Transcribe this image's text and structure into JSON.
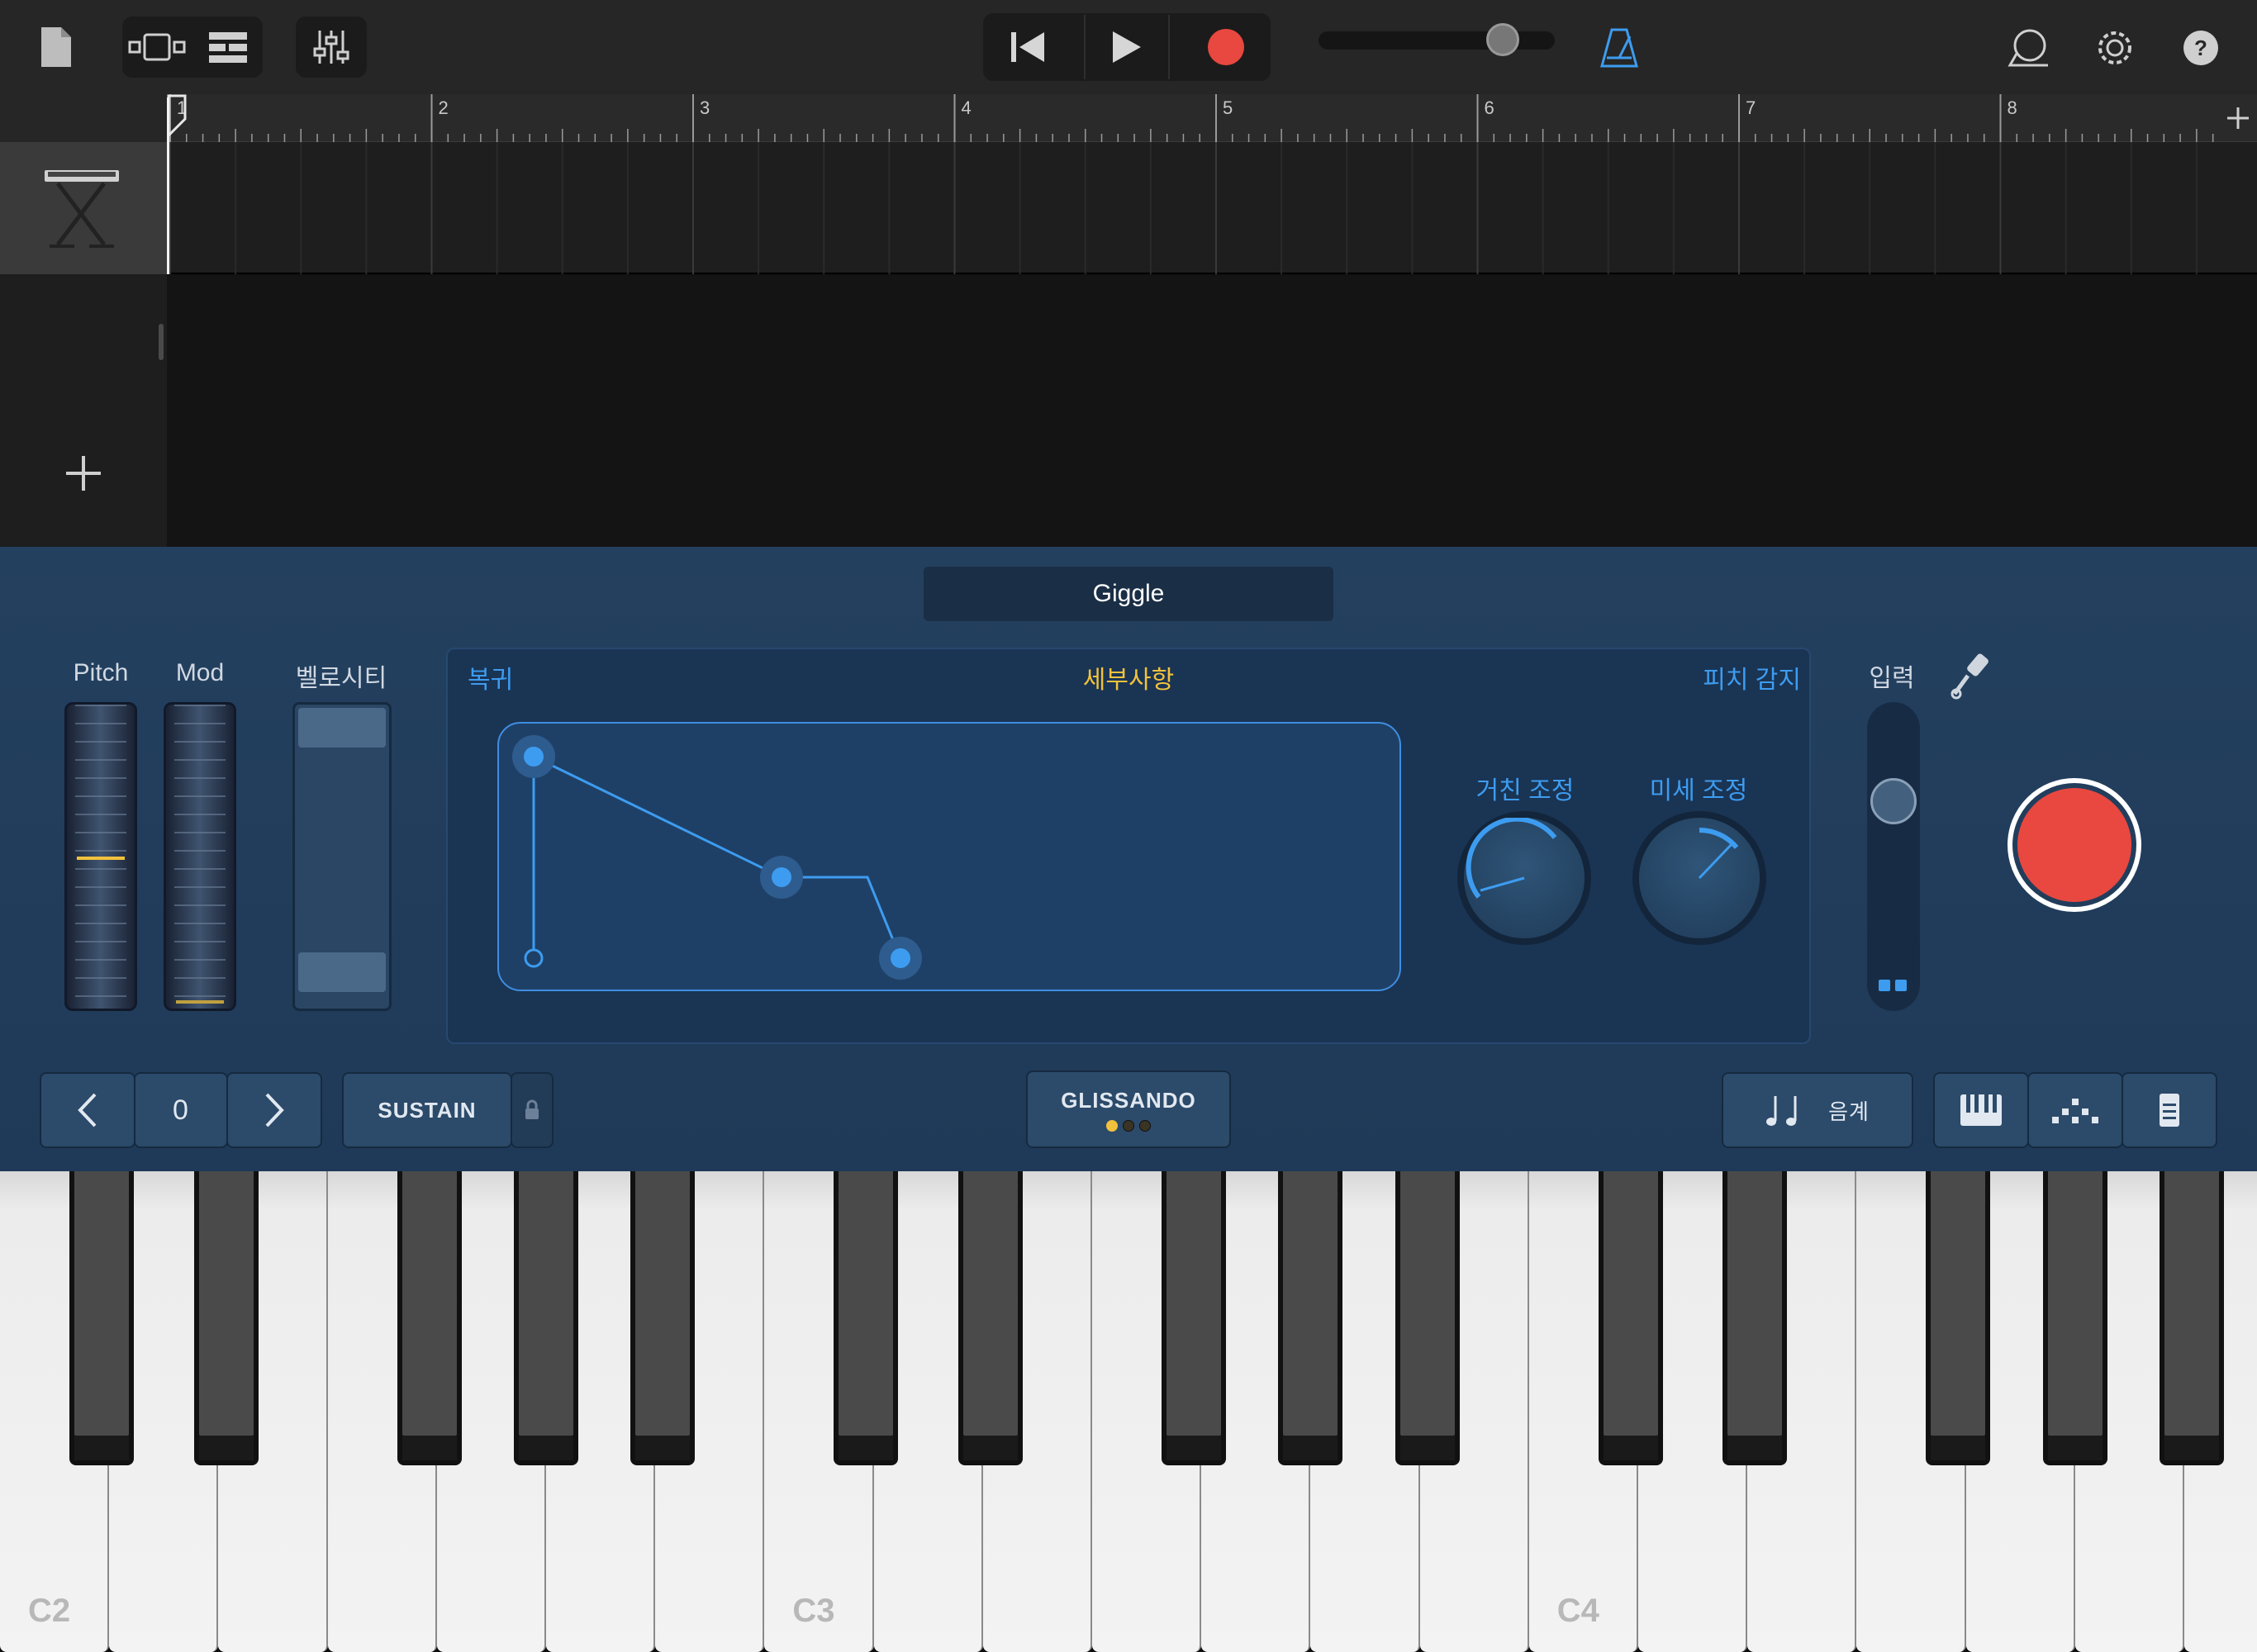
{
  "transport": {
    "rewind": "rewind-icon",
    "play": "play-icon",
    "record": "record-icon",
    "volume_level": 0.78
  },
  "timeline": {
    "bar_numbers": [
      "1",
      "2",
      "3",
      "4",
      "5",
      "6",
      "7",
      "8"
    ]
  },
  "instrument": {
    "preset_name": "Giggle",
    "pitch_label": "Pitch",
    "mod_label": "Mod",
    "velocity_label": "벨로시티",
    "revert_label": "복귀",
    "details_label": "세부사항",
    "pitch_detect_label": "피치 감지",
    "coarse_label": "거친 조정",
    "fine_label": "미세 조정",
    "input_label": "입력"
  },
  "controls": {
    "octave_value": "0",
    "sustain_label": "SUSTAIN",
    "glissando_label": "GLISSANDO",
    "scale_label": "음계"
  },
  "keyboard": {
    "note_labels": [
      "C2",
      "C3",
      "C4"
    ]
  },
  "colors": {
    "accent_blue": "#3d9cf0",
    "record_red": "#e8483f",
    "details_yellow": "#f2c23c"
  }
}
